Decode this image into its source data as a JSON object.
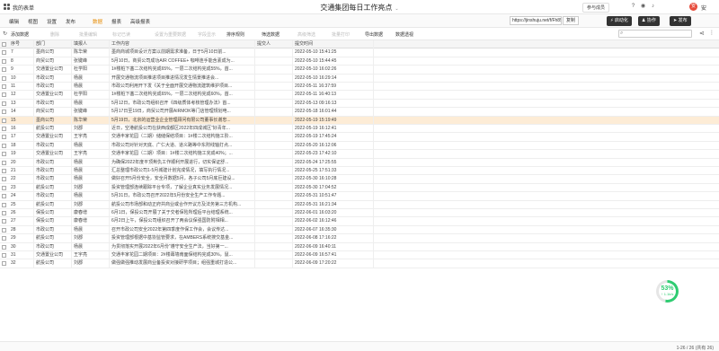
{
  "app": {
    "name": "我的表单",
    "doc_title": "交通集团每日工作亮点",
    "users": "参与成员",
    "user_name": "安",
    "avatar_letter": "安"
  },
  "menu": {
    "items": [
      "编辑",
      "视图",
      "设置",
      "发布"
    ],
    "tabs": [
      "数据",
      "报表",
      "高级报表"
    ],
    "active_tab": "数据",
    "url": "https://jinshuju.net/f/Fh85qh",
    "copy": "复制",
    "actions": [
      "启动化",
      "协作",
      "发布"
    ]
  },
  "toolbar": {
    "items": [
      "添加数据",
      "删除",
      "批量编辑",
      "标记已读",
      "设置为重要数据",
      "字段显示",
      "排序规则",
      "筛选数据",
      "高级筛选",
      "批量打印",
      "导出数据",
      "数据透视"
    ],
    "enabled": [
      true,
      false,
      false,
      false,
      false,
      false,
      true,
      true,
      false,
      false,
      true,
      true
    ]
  },
  "table": {
    "columns": [
      "序号",
      "部门",
      "填报人",
      "工作内容",
      "提交人",
      "提交时间"
    ],
    "rows": [
      {
        "n": "7",
        "dept": "墨商公司",
        "who": "陈华荣",
        "content": "墨商商城项目设计方案以前期需求准备，日于5月10日前...",
        "sub": "",
        "time": "2022-05-10 15:41:25"
      },
      {
        "n": "8",
        "dept": "商贸公司",
        "who": "张键峰",
        "content": "5月10日，商贸公司成功AIR COFFEE+ 咖啡连手能含素成为...",
        "sub": "",
        "time": "2022-05-10 15:44:45"
      },
      {
        "n": "9",
        "dept": "交通置业公司",
        "who": "杜学阳",
        "content": "1#楼桩下塞二次结构完成65%，一层二次结构完成55%，首...",
        "sub": "",
        "time": "2022-05-10 16:02:26"
      },
      {
        "n": "10",
        "dept": "市政公司",
        "who": "杨晨",
        "content": "开展交通物流项目推进项目推进情况发生情景推进会...",
        "sub": "",
        "time": "2022-05-10 16:29:14"
      },
      {
        "n": "11",
        "dept": "市政公司",
        "who": "杨晨",
        "content": "市政公司利用开下发《关于全面开展交通物流建筑维护项目...",
        "sub": "",
        "time": "2022-05-11 16:37:59"
      },
      {
        "n": "12",
        "dept": "交通置业公司",
        "who": "杜学阳",
        "content": "1#楼桩下塞二次结构完成65%，一层二次结构完成60%，首...",
        "sub": "",
        "time": "2022-05-11 16:40:13"
      },
      {
        "n": "13",
        "dept": "市政公司",
        "who": "杨晨",
        "content": "5月12日，市政公司组织召开《四级质体考核管理办法》首...",
        "sub": "",
        "time": "2022-05-13 09:16:13"
      },
      {
        "n": "14",
        "dept": "商贸公司",
        "who": "张键峰",
        "content": "5月17日至19日，商贸公司开展AIRMOK等门店管理规划电...",
        "sub": "",
        "time": "2022-05-18 16:01:44"
      },
      {
        "n": "15",
        "dept": "墨商公司",
        "who": "陈华荣",
        "content": "5月19日，北京的运营业企业管理顾问有限公司董事长谢忠...",
        "sub": "",
        "time": "2022-05-19 15:19:49"
      },
      {
        "n": "16",
        "dept": "航投公司",
        "who": "刘郡",
        "content": "近日，空港航投公司在获西成都区2022年四成城区“好青年...",
        "sub": "",
        "time": "2022-05-19 16:12:41"
      },
      {
        "n": "17",
        "dept": "交通置业公司",
        "who": "王宇亮",
        "content": "交通丰家花园（二期）储储保结项目：1#楼二次结构施工阶...",
        "sub": "",
        "time": "2022-05-19 17:45:24"
      },
      {
        "n": "18",
        "dept": "市政公司",
        "who": "杨晨",
        "content": "市政公司对针对天底、广仁大道、道义路等中东附线轴打点...",
        "sub": "",
        "time": "2022-05-20 16:12:06"
      },
      {
        "n": "19",
        "dept": "交通置业公司",
        "who": "王宇亮",
        "content": "交通丰家花园（二期）项目：1#楼二次结构施工完成40%；...",
        "sub": "",
        "time": "2022-05-23 17:42:10"
      },
      {
        "n": "20",
        "dept": "市政公司",
        "who": "杨晨",
        "content": "为确保2022年度平顶荆仇工作顺利开展进行，切实保证舒...",
        "sub": "",
        "time": "2022-05-24 17:25:55"
      },
      {
        "n": "21",
        "dept": "市政公司",
        "who": "杨晨",
        "content": "汇总整理市政公司1-5月城建计划完成情况，填写执行情况...",
        "sub": "",
        "time": "2022-05-25 17:51:33"
      },
      {
        "n": "22",
        "dept": "市政公司",
        "who": "杨晨",
        "content": "做好召开5月份安全，安全月数据5月，各子公司5月底巨建设...",
        "sub": "",
        "time": "2022-05-30 16:10:28"
      },
      {
        "n": "23",
        "dept": "航投公司",
        "who": "刘郡",
        "content": "投资管理部连续跟踪平台专项，了解企业真实业务发展情况...",
        "sub": "",
        "time": "2022-05-30 17:04:52"
      },
      {
        "n": "24",
        "dept": "市政公司",
        "who": "杨晨",
        "content": "5月31日，市政公司召开2022年5月份安全生产工作专题...",
        "sub": "",
        "time": "2022-05-31 10:51:47"
      },
      {
        "n": "25",
        "dept": "航投公司",
        "who": "刘郡",
        "content": "航投公司市场部和动正府共商业或合作开议方及法务第三方机构...",
        "sub": "",
        "time": "2022-05-31 16:21:34"
      },
      {
        "n": "26",
        "dept": "保投公司",
        "who": "康春增",
        "content": "6月1日，保投公司开展了关于交者保险所理后平台结理系统...",
        "sub": "",
        "time": "2022-06-01 16:03:20"
      },
      {
        "n": "27",
        "dept": "保投公司",
        "who": "康春增",
        "content": "6月2日上午，保投公司组织召开了两会议保强国防附相相...",
        "sub": "",
        "time": "2022-06-02 16:12:46"
      },
      {
        "n": "28",
        "dept": "市政公司",
        "who": "杨晨",
        "content": "召开市政公司安全2022年第四季度作保工作会，会议传达...",
        "sub": "",
        "time": "2022-06-07 16:35:30"
      },
      {
        "n": "29",
        "dept": "航投公司",
        "who": "刘郡",
        "content": "投资管理部根据中基协监管要求，在AMBERS系统搜交基金...",
        "sub": "",
        "time": "2022-06-08 17:16:22"
      },
      {
        "n": "30",
        "dept": "市政公司",
        "who": "杨晨",
        "content": "为贯彻落实开展2022年6月份“遵守安全生产法，当好第一...",
        "sub": "",
        "time": "2022-06-09 16:40:11"
      },
      {
        "n": "31",
        "dept": "交通置业公司",
        "who": "王宇亮",
        "content": "交通丰家花园二期项目：2#楼幕墙南面保结构完成30%，鼠...",
        "sub": "",
        "time": "2022-06-09 16:57:41"
      },
      {
        "n": "32",
        "dept": "航投公司",
        "who": "刘郡",
        "content": "做强做强推动发展商业备投资对接研学项目；组强重城打造公...",
        "sub": "",
        "time": "2022-06-09 17:20:22"
      }
    ],
    "highlight_row": "15"
  },
  "status": {
    "count": "1-26 / 26 (共有 26)"
  },
  "gauge": {
    "percent": 53,
    "label": "53%",
    "speed": "↑ 1.1k/s"
  }
}
